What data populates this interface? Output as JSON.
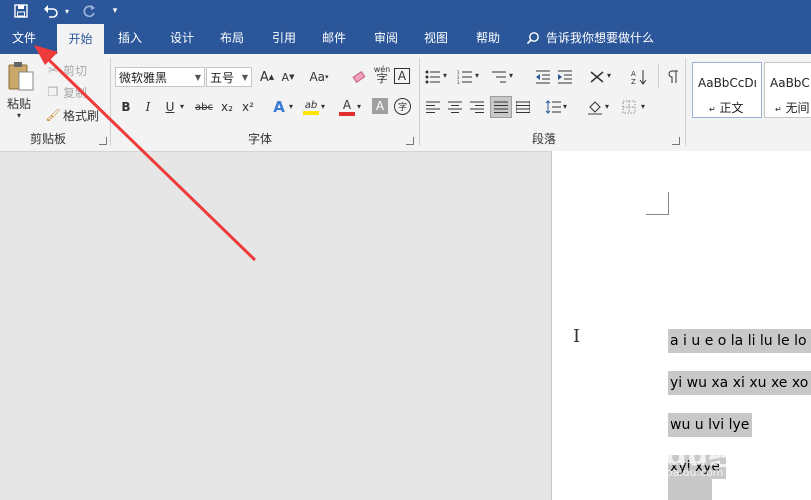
{
  "quick_access": {
    "save_icon": "save-icon",
    "undo_icon": "undo-icon",
    "redo_icon": "redo-icon",
    "customize": "▾"
  },
  "tabs": [
    "文件",
    "开始",
    "插入",
    "设计",
    "布局",
    "引用",
    "邮件",
    "审阅",
    "视图",
    "帮助"
  ],
  "tell_me": "告诉我你想要做什么",
  "clipboard": {
    "paste": "粘贴",
    "cut": "剪切",
    "copy": "复制",
    "format_painter": "格式刷",
    "group": "剪贴板"
  },
  "font": {
    "name": "微软雅黑",
    "size": "五号",
    "group": "字体",
    "grow": "A",
    "shrink": "A",
    "change_case": "Aa",
    "clear": "",
    "phonetic_top": "wén",
    "phonetic_bottom": "字",
    "border": "A",
    "bold": "B",
    "italic": "I",
    "underline": "U",
    "strike": "abc",
    "sub": "x₂",
    "sup": "x²",
    "effects": "A",
    "highlight": "ab",
    "color": "A",
    "shading": "A",
    "enclose": "字"
  },
  "paragraph": {
    "group": "段落"
  },
  "styles": [
    {
      "sample": "AaBbCcDı",
      "name": "正文"
    },
    {
      "sample": "AaBbC",
      "name": "无间"
    }
  ],
  "colors": {
    "accent": "#2b579a",
    "highlight": "#ffe500",
    "font_red": "#e03030"
  },
  "document": {
    "lines": [
      "a i u e o la li lu le lo",
      "yi wu xa xi xu xe xo",
      "wu u lvi lye",
      "xyi xye"
    ]
  },
  "watermark": {
    "brand": "Baidu经验",
    "url": "jingyan.baidu.com"
  }
}
